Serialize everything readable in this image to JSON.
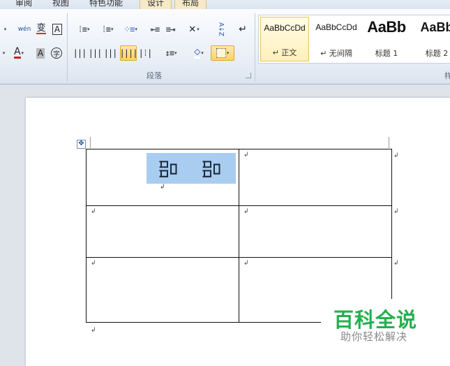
{
  "tabs": [
    "审阅",
    "视图",
    "特色功能",
    "设计",
    "布局"
  ],
  "paragraph_group": {
    "title": "段落"
  },
  "styles_group": {
    "title_partial": "样",
    "items": [
      {
        "sample": "AaBbCcDd",
        "name": "↵ 正文",
        "selected": true
      },
      {
        "sample": "AaBbCcDd",
        "name": "↵ 无间隔",
        "selected": false
      },
      {
        "sample": "AaBb",
        "name": "标题 1",
        "selected": false
      },
      {
        "sample": "AaBb",
        "name": "标题 2",
        "selected": false
      }
    ]
  },
  "ribbon_icons": {
    "row1": [
      "phonetic-guide-icon",
      "enclose-char-icon",
      "char-border-icon",
      "bullets-icon",
      "numbering-icon",
      "multilevel-list-icon",
      "decrease-indent-icon",
      "increase-indent-icon",
      "chinese-layout-icon",
      "sort-icon",
      "show-marks-icon"
    ],
    "row2": [
      "font-color-icon",
      "char-shading-icon",
      "enclose-circle-icon",
      "align-left-icon",
      "align-center-icon",
      "align-right-icon",
      "justify-icon",
      "distributed-icon",
      "line-spacing-icon",
      "shading-icon",
      "borders-icon"
    ]
  },
  "icon_glyphs": {
    "sort": "A↓Z",
    "show_marks": "↵",
    "font_color": "A",
    "char_shading": "A",
    "enclose": "字",
    "phonetic": "wén",
    "char_border": "A"
  },
  "colors": {
    "accent_active": "#ffd35f",
    "selection": "#a9cdf0",
    "watermark_green": "#23b14d"
  },
  "document": {
    "table": {
      "rows": 3,
      "cols": 2,
      "cell_1_1_text": [
        "品",
        "品"
      ],
      "end_of_cell_mark": "↲"
    },
    "paragraph_mark": "↲"
  },
  "watermark": {
    "title": "百科全说",
    "subtitle": "助你轻松解决"
  }
}
